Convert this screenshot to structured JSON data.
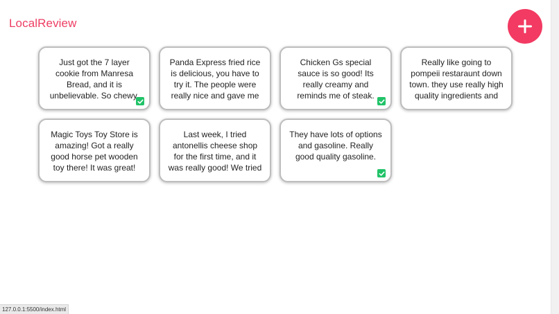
{
  "app": {
    "logo": "LocalReview"
  },
  "fab": {
    "icon": "plus-icon",
    "color": "#f23a62"
  },
  "reviews": [
    {
      "text": "Just got the 7 layer cookie from Manresa Bread, and it is unbelievable. So chewy,",
      "checked": true
    },
    {
      "text": "Panda Express fried rice is delicious, you have to try it. The people were really nice and gave me an extra egg",
      "checked": false
    },
    {
      "text": "Chicken Gs special sauce is so good! Its really creamy and reminds me of steak. Would highly",
      "checked": true
    },
    {
      "text": "Really like going to pompeii restaraunt down town. they use really high quality ingredients and serve a",
      "checked": false
    },
    {
      "text": "Magic Toys Toy Store is amazing! Got a really good horse pet wooden toy there! It was great!",
      "checked": false
    },
    {
      "text": "Last week, I tried antonellis cheese shop for the first time, and it was really good! We tried a cheddar cheese.",
      "checked": false
    },
    {
      "text": "They have lots of options and gasoline. Really good quality gasoline.",
      "checked": true
    }
  ],
  "status_bar": {
    "url": "127.0.0.1:5500/index.html"
  },
  "colors": {
    "brand": "#ee3d63",
    "check": "#21c368"
  }
}
